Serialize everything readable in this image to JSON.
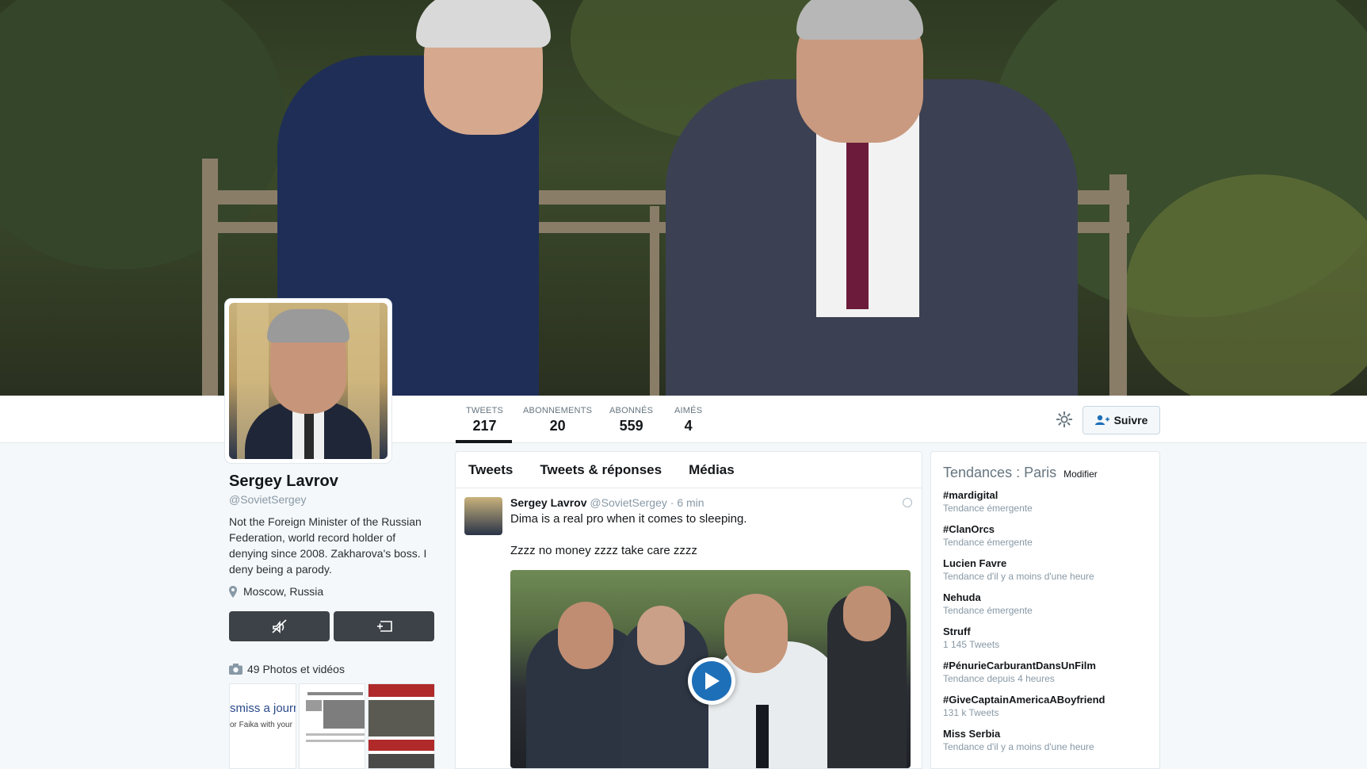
{
  "profile": {
    "name": "Sergey Lavrov",
    "handle": "@SovietSergey",
    "bio": "Not the Foreign Minister of the Russian Federation, world record holder of denying since 2008. Zakharova's boss. I deny being a parody.",
    "location": "Moscow, Russia",
    "photos_label": "49 Photos et vidéos",
    "thumb1_text": "smiss a journa",
    "thumb1_sub": "or Faika with your"
  },
  "stats": [
    {
      "label": "TWEETS",
      "value": "217"
    },
    {
      "label": "ABONNEMENTS",
      "value": "20"
    },
    {
      "label": "ABONNÉS",
      "value": "559"
    },
    {
      "label": "AIMÉS",
      "value": "4"
    }
  ],
  "follow_button": {
    "label": "Suivre"
  },
  "tabs": [
    "Tweets",
    "Tweets & réponses",
    "Médias"
  ],
  "tweet": {
    "name": "Sergey Lavrov",
    "handle": "@SovietSergey",
    "time": "· 6 min",
    "line1": "Dima is a real pro when it comes to sleeping.",
    "line2": "Zzzz no money zzzz take care zzzz"
  },
  "trends": {
    "title": "Tendances : Paris",
    "modify": "Modifier",
    "items": [
      {
        "name": "#mardigital",
        "desc": "Tendance émergente"
      },
      {
        "name": "#ClanOrcs",
        "desc": "Tendance émergente"
      },
      {
        "name": "Lucien Favre",
        "desc": "Tendance d'il y a moins d'une heure"
      },
      {
        "name": "Nehuda",
        "desc": "Tendance émergente"
      },
      {
        "name": "Struff",
        "desc": "1 145 Tweets"
      },
      {
        "name": "#PénurieCarburantDansUnFilm",
        "desc": "Tendance depuis 4 heures"
      },
      {
        "name": "#GiveCaptainAmericaABoyfriend",
        "desc": "131 k Tweets"
      },
      {
        "name": "Miss Serbia",
        "desc": "Tendance d'il y a moins d'une heure"
      }
    ]
  },
  "colors": {
    "accent": "#1d6fb8",
    "text": "#14171a",
    "muted": "#8899a6",
    "button_dark": "#3c4247"
  }
}
